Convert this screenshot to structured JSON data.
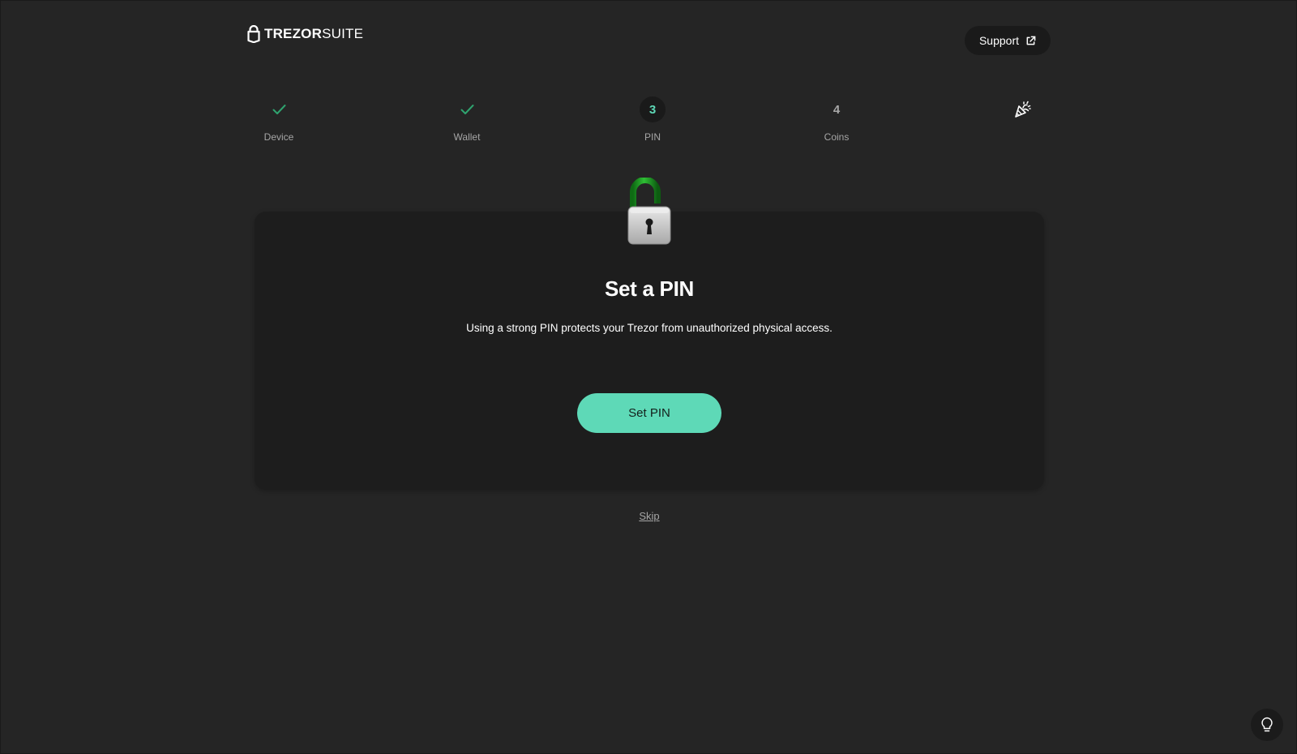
{
  "header": {
    "logo_bold": "TREZOR",
    "logo_thin": "SUITE",
    "support_label": "Support"
  },
  "stepper": {
    "steps": [
      {
        "label": "Device",
        "status": "done"
      },
      {
        "label": "Wallet",
        "status": "done"
      },
      {
        "label": "PIN",
        "number": "3",
        "status": "active"
      },
      {
        "label": "Coins",
        "number": "4",
        "status": "upcoming"
      },
      {
        "label": "",
        "status": "final"
      }
    ]
  },
  "card": {
    "title": "Set a PIN",
    "description": "Using a strong PIN protects your Trezor from unauthorized physical access.",
    "primary_button": "Set PIN"
  },
  "skip_label": "Skip",
  "icons": {
    "logo": "trezor-lock-icon",
    "support": "external-link-icon",
    "done": "check-icon",
    "final": "party-popper-icon",
    "illustration": "padlock-unlocked-icon",
    "tips": "lightbulb-icon"
  },
  "colors": {
    "background": "#252525",
    "card": "#1d1d1d",
    "accent": "#5ed9b7",
    "check": "#2fa36f"
  }
}
